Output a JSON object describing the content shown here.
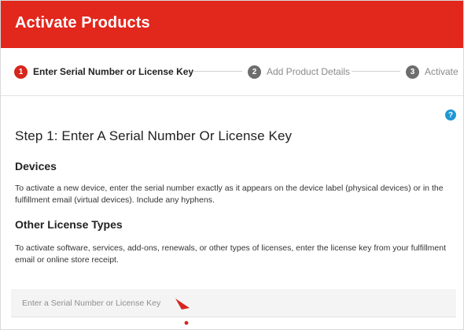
{
  "header": {
    "title": "Activate Products"
  },
  "stepper": {
    "steps": [
      {
        "number": "1",
        "label": "Enter Serial Number or License Key",
        "state": "active"
      },
      {
        "number": "2",
        "label": "Add Product Details",
        "state": "inactive"
      },
      {
        "number": "3",
        "label": "Activate",
        "state": "inactive"
      }
    ]
  },
  "help": {
    "icon": "question-circle-icon",
    "glyph": "?"
  },
  "main": {
    "step_heading": "Step 1: Enter A Serial Number Or License Key",
    "devices": {
      "heading": "Devices",
      "text": "To activate a new device, enter the serial number exactly as it appears on the device label (physical devices) or in the fulfillment email (virtual devices). Include any hyphens."
    },
    "other_license": {
      "heading": "Other License Types",
      "text": "To activate software, services, add-ons, renewals, or other types of licenses, enter the license key from your fulfillment email or online store receipt."
    }
  },
  "serial_input": {
    "placeholder": "Enter a Serial Number or License Key",
    "value": ""
  },
  "colors": {
    "brand_red": "#e2271d",
    "step_active": "#d6261d",
    "step_inactive": "#6d6d6d",
    "help_blue": "#1f97d4",
    "input_bg": "#f4f4f4"
  }
}
